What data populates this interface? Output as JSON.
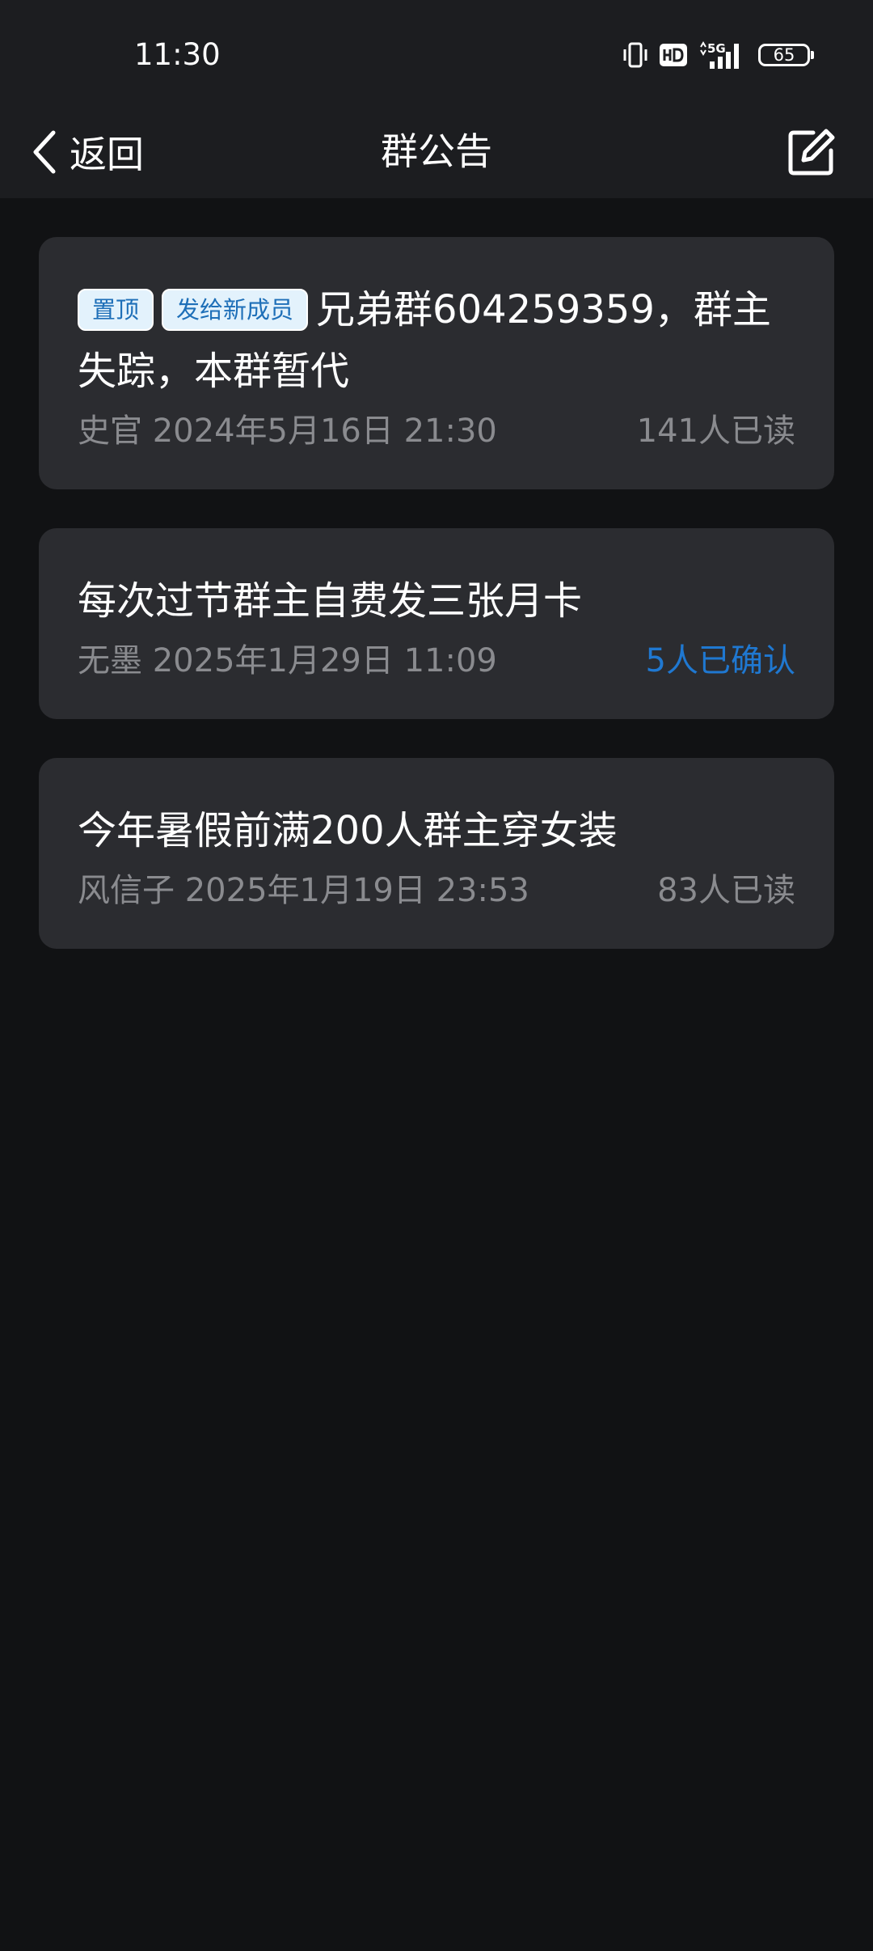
{
  "status_bar": {
    "time": "11:30",
    "battery": "65",
    "icons": [
      "vibrate-icon",
      "hd-icon",
      "5g-signal-icon",
      "battery-icon"
    ]
  },
  "nav": {
    "back_label": "返回",
    "title": "群公告",
    "edit_icon": "edit-icon"
  },
  "announcements": [
    {
      "tags": [
        "置顶",
        "发给新成员"
      ],
      "title": "兄弟群604259359，群主失踪，本群暂代",
      "author": "史官",
      "date": "2024年5月16日 21:30",
      "status": "141人已读"
    },
    {
      "title": "每次过节群主自费发三张月卡",
      "author": "无墨",
      "date": "2025年1月29日 11:09",
      "status": "5人已确认"
    },
    {
      "title": "今年暑假前满200人群主穿女装",
      "author": "风信子",
      "date": "2025年1月19日 23:53",
      "status": "83人已读"
    }
  ],
  "colors": {
    "background": "#111214",
    "bar": "#1c1d20",
    "card": "#2b2c30",
    "meta": "#8a8b8f",
    "accent": "#1f78d1",
    "tag_bg": "#e3f2fc",
    "tag_text": "#1e6fb8"
  }
}
